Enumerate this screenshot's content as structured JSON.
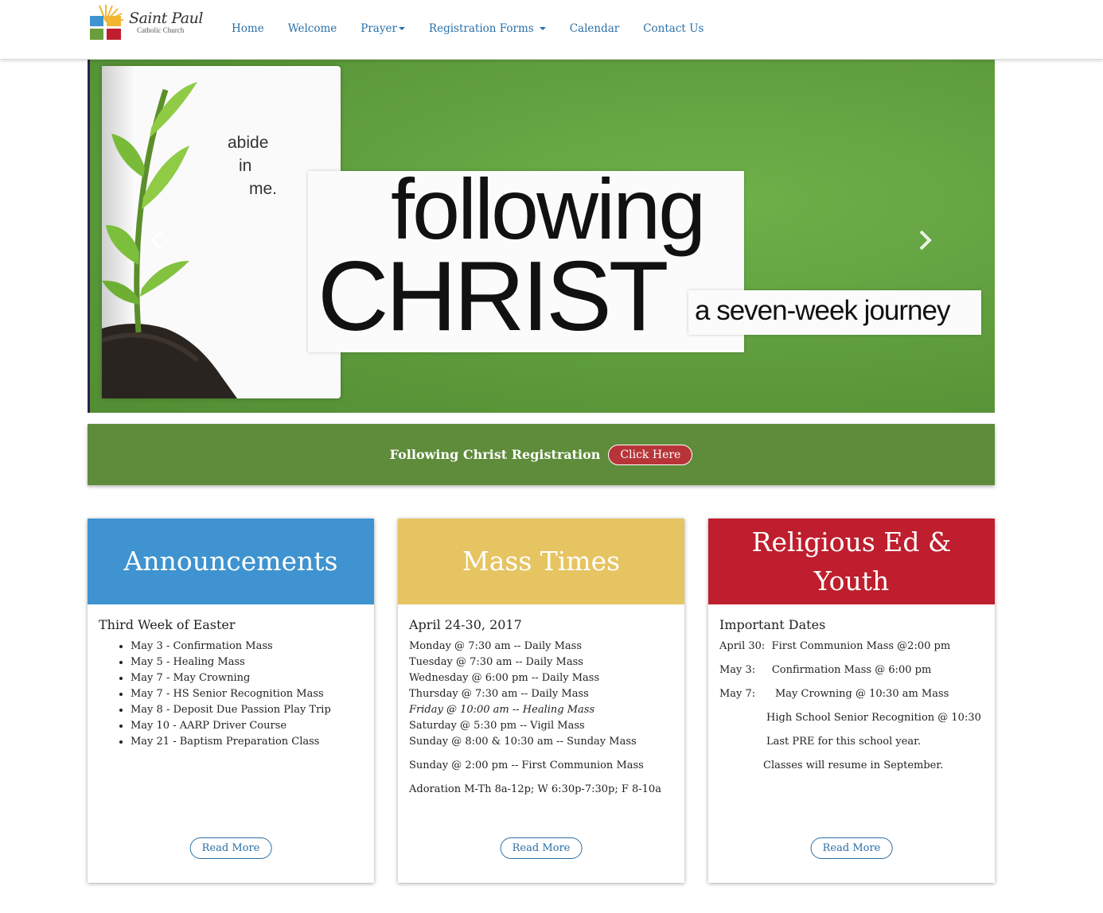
{
  "logo": {
    "name": "Saint Paul",
    "subtitle": "Catholic Church",
    "colors": [
      "#f2b632",
      "#3e93d0",
      "#6a9e3b",
      "#be1e2d"
    ]
  },
  "nav": {
    "items": [
      {
        "label": "Home",
        "dropdown": false
      },
      {
        "label": "Welcome",
        "dropdown": false
      },
      {
        "label": "Prayer",
        "dropdown": true
      },
      {
        "label": "Registration Forms",
        "dropdown": true
      },
      {
        "label": "Calendar",
        "dropdown": false
      },
      {
        "label": "Contact Us",
        "dropdown": false
      }
    ],
    "link_color": "#2a6fa8"
  },
  "hero": {
    "abide": [
      "abide",
      "in",
      "me."
    ],
    "line1": "following",
    "line2": "CHRIST",
    "tagline": "a seven-week journey",
    "prev_icon": "chevron-left-icon",
    "next_icon": "chevron-right-icon",
    "background": "#5f9e3e"
  },
  "banner": {
    "text": "Following Christ Registration",
    "button": "Click Here",
    "background": "#5f8c3b",
    "button_color": "#b73539"
  },
  "cards": [
    {
      "title": "Announcements",
      "color": "#3e93d0",
      "subtitle": "Third Week of Easter",
      "items": [
        "May 3 - Confirmation Mass",
        "May 5 - Healing Mass",
        "May 7 - May Crowning",
        "May 7 - HS Senior Recognition Mass",
        "May 8 -  Deposit Due Passion Play Trip",
        "May 10 - AARP Driver Course",
        "May 21 - Baptism Preparation Class"
      ],
      "button": "Read More"
    },
    {
      "title": "Mass Times",
      "color": "#e6c462",
      "subtitle": "April 24-30, 2017",
      "lines": [
        "Monday @ 7:30 am -- Daily Mass",
        "Tuesday @ 7:30 am  -- Daily Mass",
        "Wednesday @ 6:00 pm -- Daily Mass",
        "Thursday @ 7:30 am -- Daily Mass",
        "Friday @ 10:00 am -- Healing Mass",
        "Saturday @ 5:30 pm -- Vigil Mass",
        "Sunday  @ 8:00 & 10:30 am -- Sunday Mass",
        "Sunday @ 2:00 pm -- First Communion Mass",
        "Adoration M-Th 8a-12p; W 6:30p-7:30p; F 8-10a"
      ],
      "button": "Read More"
    },
    {
      "title": "Religious Ed & Youth",
      "color": "#be1e2d",
      "subtitle": "Important Dates",
      "lines": [
        "April 30:  First Communion Mass @2:00 pm",
        "May 3:     Confirmation Mass @ 6:00 pm",
        "May 7:      May Crowning @ 10:30 am Mass",
        "High School Senior Recognition @ 10:30",
        "Last PRE for this school year.",
        "Classes will resume in September."
      ],
      "button": "Read More"
    }
  ]
}
